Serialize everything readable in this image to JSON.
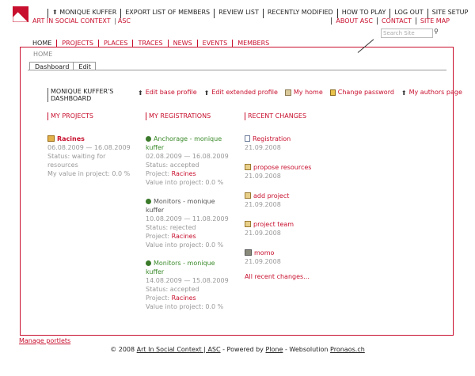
{
  "topnav": [
    "MONIQUE KUFFER",
    "EXPORT LIST OF MEMBERS",
    "REVIEW LIST",
    "RECENTLY MODIFIED",
    "HOW TO PLAY",
    "LOG OUT",
    "SITE SETUP"
  ],
  "site": {
    "name": "ART IN SOCIAL CONTEXT",
    "sep": "|",
    "abbr": "ASC"
  },
  "rightlinks": [
    "ABOUT ASC",
    "CONTACT",
    "SITE MAP"
  ],
  "search": {
    "placeholder": "Search Site"
  },
  "mainnav": [
    "HOME",
    "PROJECTS",
    "PLACES",
    "TRACES",
    "NEWS",
    "EVENTS",
    "MEMBERS"
  ],
  "breadcrumb": "HOME",
  "tabs": [
    "Dashboard",
    "Edit"
  ],
  "dashboard_title": "MONIQUE KUFFER'S DASHBOARD",
  "actions": [
    "Edit base profile",
    "Edit extended profile",
    "My home",
    "Change password",
    "My authors page"
  ],
  "projects": {
    "header": "MY PROJECTS",
    "items": [
      {
        "name": "Racines",
        "dates": "06.08.2009 — 16.08.2009",
        "status": "Status: waiting for resources",
        "value": "My value in project: 0.0 %"
      }
    ]
  },
  "registrations": {
    "header": "MY REGISTRATIONS",
    "items": [
      {
        "name": "Anchorage - monique kuffer",
        "dates": "02.08.2009 — 16.08.2009",
        "status": "Status: accepted",
        "project_label": "Project:",
        "project": "Racines",
        "value": "Value into project: 0.0 %"
      },
      {
        "name": "Monitors - monique kuffer",
        "dates": "10.08.2009 — 11.08.2009",
        "status": "Status: rejected",
        "project_label": "Project:",
        "project": "Racines",
        "value": "Value into project: 0.0 %"
      },
      {
        "name": "Monitors - monique kuffer",
        "dates": "14.08.2009 — 15.08.2009",
        "status": "Status: accepted",
        "project_label": "Project:",
        "project": "Racines",
        "value": "Value into project: 0.0 %"
      }
    ]
  },
  "recent": {
    "header": "RECENT CHANGES",
    "items": [
      {
        "title": "Registration",
        "date": "21.09.2008"
      },
      {
        "title": "propose resources",
        "date": "21.09.2008"
      },
      {
        "title": "add project",
        "date": "21.09.2008"
      },
      {
        "title": "project team",
        "date": "21.09.2008"
      },
      {
        "title": "momo",
        "date": "21.09.2008"
      }
    ],
    "all_link": "All recent changes..."
  },
  "manage_portlets": "Manage portlets",
  "footer": {
    "copy": "© 2008",
    "site": "Art In Social Context | ASC",
    "powered": " - Powered by ",
    "plone": "Plone",
    "web": " - Websolution ",
    "pronaos": "Pronaos.ch"
  }
}
